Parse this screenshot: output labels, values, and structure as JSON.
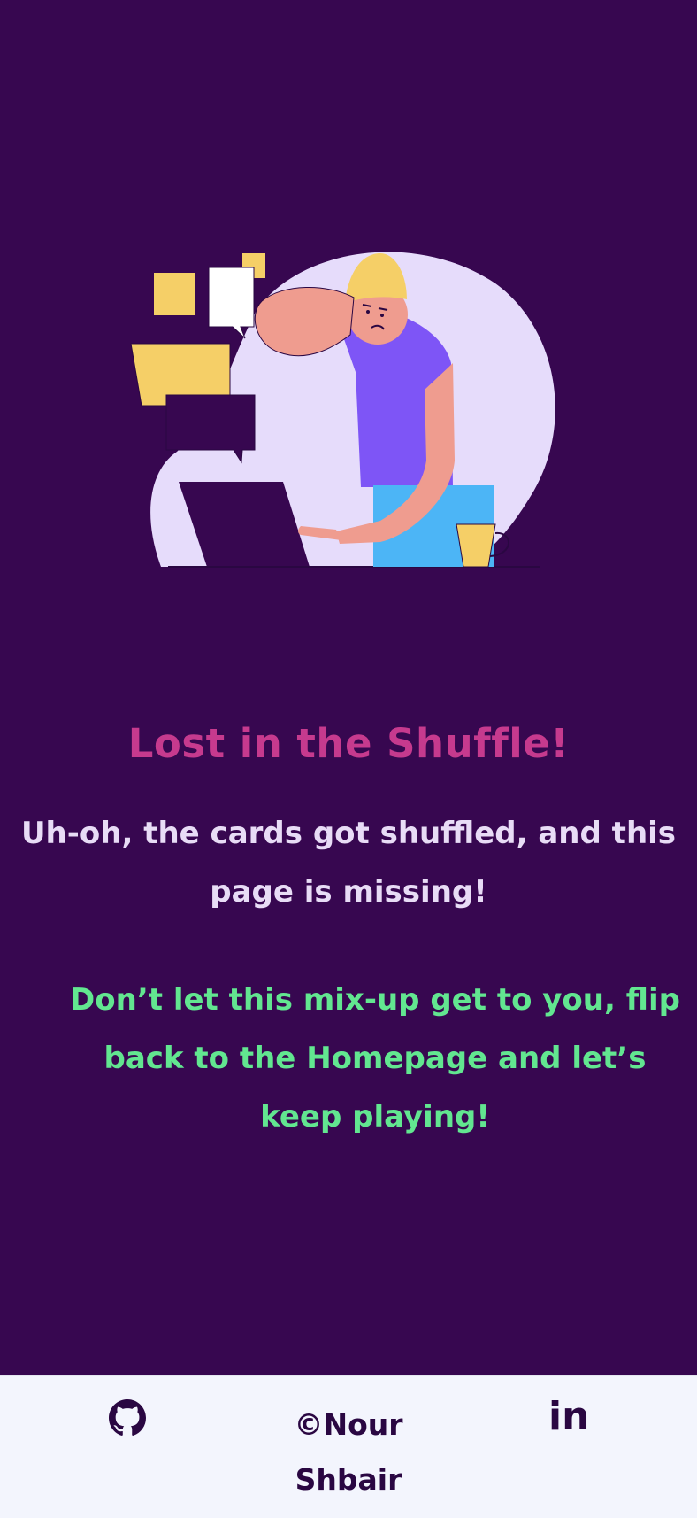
{
  "page": {
    "title": "Lost in the Shuffle!",
    "message": "Uh-oh, the cards got shuffled, and this page is missing!",
    "cta": "Don’t let this mix-up get to you, flip back to the Homepage and let’s keep playing!"
  },
  "footer": {
    "copyright": "©Nour Shbair",
    "linkedin_label": "in",
    "icons": [
      "github-icon",
      "linkedin-icon"
    ]
  },
  "colors": {
    "background": "#370750",
    "title": "#c63a8e",
    "message": "#e8dcf6",
    "cta": "#62e690",
    "footer_bg": "#f3f5fd",
    "footer_text": "#2a0742"
  }
}
